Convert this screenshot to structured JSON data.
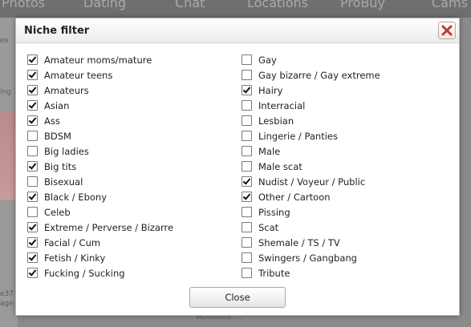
{
  "background": {
    "nav_items": [
      "Photos",
      "Dating",
      "Chat",
      "Locations",
      "ProBuy",
      "Cams"
    ],
    "left_fragments": [
      "es",
      "ing 1",
      "e37",
      "age"
    ],
    "bottom_text": "Absolute ..."
  },
  "modal": {
    "title": "Niche filter",
    "close_button_label": "Close",
    "left_column": [
      {
        "label": "Amateur moms/mature",
        "checked": true
      },
      {
        "label": "Amateur teens",
        "checked": true
      },
      {
        "label": "Amateurs",
        "checked": true
      },
      {
        "label": "Asian",
        "checked": true
      },
      {
        "label": "Ass",
        "checked": true
      },
      {
        "label": "BDSM",
        "checked": false
      },
      {
        "label": "Big ladies",
        "checked": false
      },
      {
        "label": "Big tits",
        "checked": true
      },
      {
        "label": "Bisexual",
        "checked": false
      },
      {
        "label": "Black / Ebony",
        "checked": true
      },
      {
        "label": "Celeb",
        "checked": false
      },
      {
        "label": "Extreme / Perverse / Bizarre",
        "checked": true
      },
      {
        "label": "Facial / Cum",
        "checked": true
      },
      {
        "label": "Fetish / Kinky",
        "checked": true
      },
      {
        "label": "Fucking / Sucking",
        "checked": true
      }
    ],
    "right_column": [
      {
        "label": "Gay",
        "checked": false
      },
      {
        "label": "Gay bizarre / Gay extreme",
        "checked": false
      },
      {
        "label": "Hairy",
        "checked": true
      },
      {
        "label": "Interracial",
        "checked": false
      },
      {
        "label": "Lesbian",
        "checked": false
      },
      {
        "label": "Lingerie / Panties",
        "checked": false
      },
      {
        "label": "Male",
        "checked": false
      },
      {
        "label": "Male scat",
        "checked": false
      },
      {
        "label": "Nudist / Voyeur / Public",
        "checked": true
      },
      {
        "label": "Other / Cartoon",
        "checked": true
      },
      {
        "label": "Pissing",
        "checked": false
      },
      {
        "label": "Scat",
        "checked": false
      },
      {
        "label": "Shemale / TS / TV",
        "checked": false
      },
      {
        "label": "Swingers / Gangbang",
        "checked": false
      },
      {
        "label": "Tribute",
        "checked": false
      }
    ]
  },
  "colors": {
    "overlay": "#8a8a8a",
    "modal_body": "#ffffff",
    "close_icon": "#c0392b"
  }
}
